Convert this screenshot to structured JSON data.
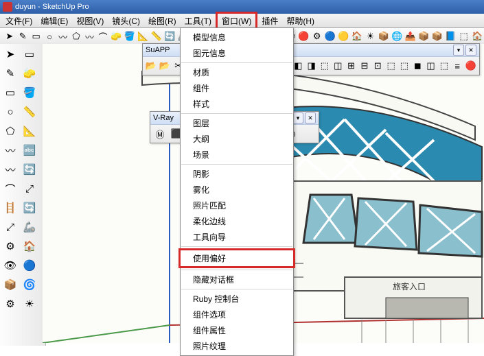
{
  "app": {
    "title": "duyun - SketchUp Pro"
  },
  "menu": {
    "items": [
      "文件(F)",
      "编辑(E)",
      "视图(V)",
      "镜头(C)",
      "绘图(R)",
      "工具(T)",
      "窗口(W)",
      "插件",
      "帮助(H)"
    ],
    "highlighted_index": 6
  },
  "dropdown": {
    "groups": [
      [
        "模型信息",
        "图元信息"
      ],
      [
        "材质",
        "组件",
        "样式"
      ],
      [
        "图层",
        "大纲",
        "场景"
      ],
      [
        "阴影",
        "雾化",
        "照片匹配",
        "柔化边线",
        "工具向导"
      ],
      [
        "使用偏好"
      ],
      [
        "隐藏对话框"
      ],
      [
        "Ruby 控制台",
        "组件选项",
        "组件属性",
        "照片纹理"
      ]
    ],
    "highlighted_label": "使用偏好"
  },
  "main_toolbar_icons": [
    "➤",
    "✎",
    "▭",
    "○",
    "〰",
    "⬠",
    "〰",
    "⌒",
    "🧽",
    "🪣",
    "📐",
    "📏",
    "🔄",
    "🦾",
    "🪜",
    "⤢",
    "▭",
    "🔍",
    "🔍",
    "🔄",
    "🔍",
    "👁",
    "🔴",
    "⚙",
    "🔵",
    "🟡",
    "🏠",
    "☀",
    "📦",
    "🌐",
    "📤",
    "📦",
    "📦",
    "📘",
    "⬚",
    "🏠"
  ],
  "left_toolbar_icons": [
    "➤",
    "▭",
    "✎",
    "🧽",
    "▭",
    "🪣",
    "○",
    "📏",
    "⬠",
    "📐",
    "〰",
    "🔤",
    "〰",
    "🔄",
    "⌒",
    "⤢",
    "🪜",
    "🔄",
    "⤢",
    "🦾",
    "⚙",
    "🏠",
    "👁",
    "🔵",
    "📦",
    "🌀",
    "⚙",
    "☀"
  ],
  "suapp": {
    "title": "SuAPP",
    "icons": [
      "📂",
      "📂",
      "✂",
      "✎",
      "✱",
      "⬚",
      "⬚",
      "〰",
      "▭",
      "⬛",
      "◼",
      "◧",
      "◨",
      "⬚",
      "◫",
      "⊞",
      "⊟",
      "⊡",
      "⬚",
      "⬚",
      "◼",
      "◫",
      "⬚",
      "≡",
      "🔴"
    ],
    "close": [
      "▾",
      "✕"
    ]
  },
  "vray": {
    "title": "V-Ray",
    "icons": [
      "Ⓜ",
      "⬛",
      "◯",
      "◻",
      "⭘",
      "✦",
      "⬚",
      "◐",
      "◉"
    ],
    "close": [
      "▾",
      "✕"
    ]
  },
  "scene": {
    "entrance_label": "旅客入口"
  }
}
